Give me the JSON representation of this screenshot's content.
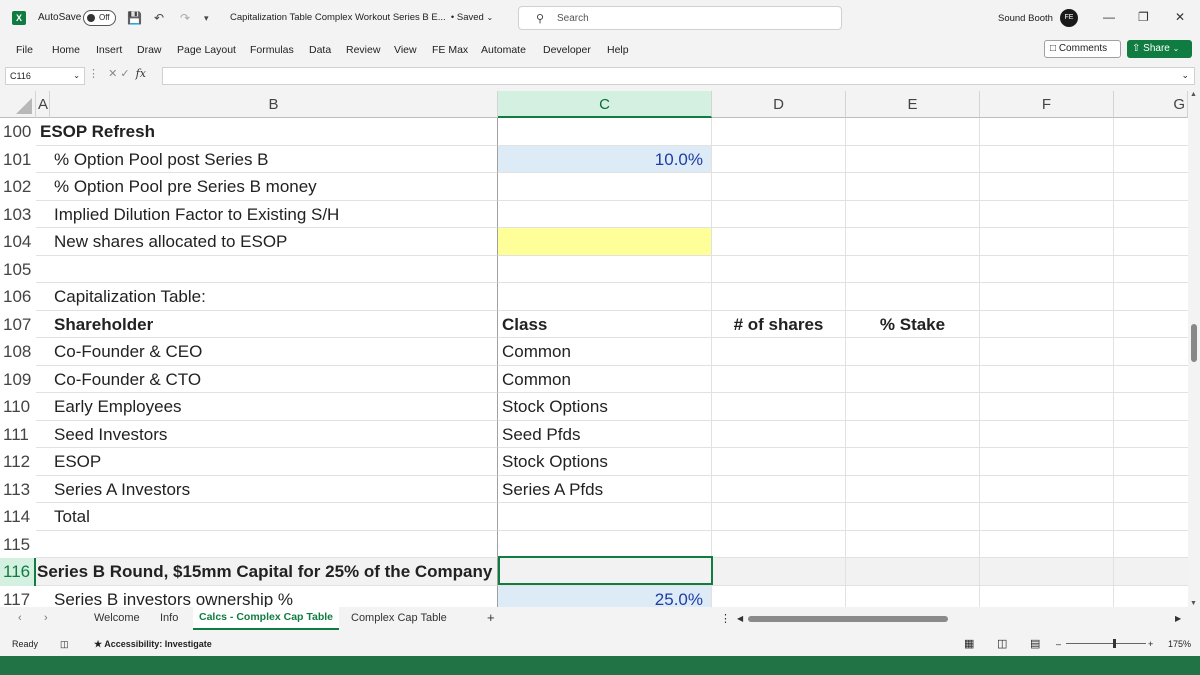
{
  "titlebar": {
    "app_icon": "X",
    "autosave_label": "AutoSave",
    "autosave_state": "Off",
    "doc_title": "Capitalization Table Complex Workout Series B E...",
    "saved_status": "• Saved",
    "search_placeholder": "Search",
    "user_name": "Sound Booth",
    "avatar_initials": "FE"
  },
  "menu": {
    "items": [
      "File",
      "Home",
      "Insert",
      "Draw",
      "Page Layout",
      "Formulas",
      "Data",
      "Review",
      "View",
      "FE Max",
      "Automate",
      "Developer",
      "Help"
    ],
    "comments_label": "Comments",
    "share_label": "Share"
  },
  "formula_bar": {
    "name_box": "C116",
    "fx": "fx",
    "formula": ""
  },
  "columns": [
    "A",
    "B",
    "C",
    "D",
    "E",
    "F",
    "G"
  ],
  "rows": [
    {
      "num": "100",
      "b": "ESOP Refresh",
      "b_bold": true
    },
    {
      "num": "101",
      "b": "% Option Pool post Series B",
      "c": "10.0%"
    },
    {
      "num": "102",
      "b": "% Option Pool pre Series B money"
    },
    {
      "num": "103",
      "b": "Implied Dilution Factor to Existing S/H"
    },
    {
      "num": "104",
      "b": "New shares allocated to ESOP"
    },
    {
      "num": "105",
      "b": ""
    },
    {
      "num": "106",
      "b": "Capitalization Table:"
    },
    {
      "num": "107",
      "b": "Shareholder",
      "c": "Class",
      "d": "# of shares",
      "e": "% Stake"
    },
    {
      "num": "108",
      "b": "Co-Founder & CEO",
      "c": "Common"
    },
    {
      "num": "109",
      "b": "Co-Founder & CTO",
      "c": "Common"
    },
    {
      "num": "110",
      "b": "Early Employees",
      "c": "Stock Options"
    },
    {
      "num": "111",
      "b": "Seed Investors",
      "c": "Seed Pfds"
    },
    {
      "num": "112",
      "b": "ESOP",
      "c": "Stock Options"
    },
    {
      "num": "113",
      "b": "Series A Investors",
      "c": "Series A Pfds"
    },
    {
      "num": "114",
      "b": "Total"
    },
    {
      "num": "115",
      "b": ""
    },
    {
      "num": "116",
      "b": "Series B Round, $15mm Capital for 25% of the Company"
    },
    {
      "num": "117",
      "b": "Series B investors ownership %",
      "c": "25.0%"
    }
  ],
  "sheets": {
    "tabs": [
      "Welcome",
      "Info",
      "Calcs - Complex Cap Table",
      "Complex Cap Table"
    ],
    "add": "+"
  },
  "status": {
    "ready": "Ready",
    "accessibility": "Accessibility: Investigate",
    "zoom": "175%"
  },
  "colors": {
    "accent": "#107c41",
    "input_fill": "#ddebf7",
    "input_text": "#1f3da3",
    "highlight_fill": "#ffff99"
  }
}
